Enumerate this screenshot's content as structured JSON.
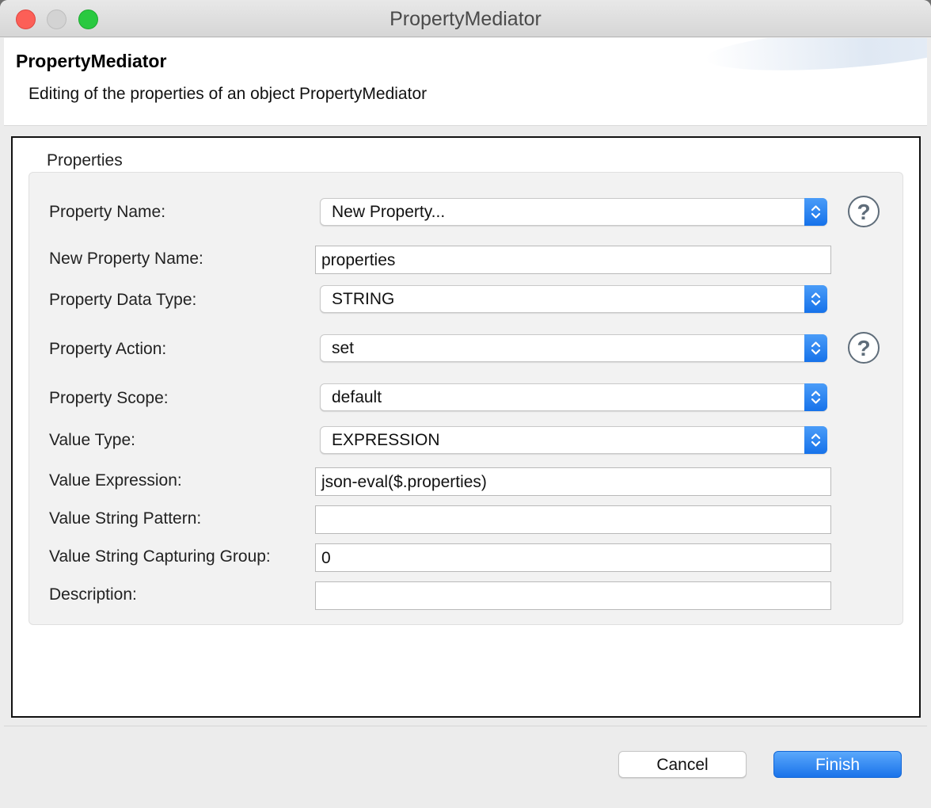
{
  "window": {
    "title": "PropertyMediator"
  },
  "header": {
    "title": "PropertyMediator",
    "description": "Editing of the properties of an object PropertyMediator"
  },
  "group": {
    "label": "Properties"
  },
  "fields": {
    "property_name": {
      "label": "Property Name:",
      "value": "New Property..."
    },
    "new_property_name": {
      "label": "New Property Name:",
      "value": "properties"
    },
    "property_data_type": {
      "label": "Property Data Type:",
      "value": "STRING"
    },
    "property_action": {
      "label": "Property Action:",
      "value": "set"
    },
    "property_scope": {
      "label": "Property Scope:",
      "value": "default"
    },
    "value_type": {
      "label": "Value Type:",
      "value": "EXPRESSION"
    },
    "value_expression": {
      "label": "Value Expression:",
      "value": "json-eval($.properties)"
    },
    "value_string_pattern": {
      "label": "Value String Pattern:",
      "value": ""
    },
    "value_string_capturing_group": {
      "label": "Value String Capturing Group:",
      "value": "0"
    },
    "description": {
      "label": "Description:",
      "value": ""
    }
  },
  "help": {
    "symbol": "?"
  },
  "buttons": {
    "cancel": "Cancel",
    "finish": "Finish"
  },
  "colors": {
    "accent": "#1a73ea",
    "close": "#fc5f57",
    "maximize": "#29c940"
  },
  "icons": {
    "help": "question-circle-icon",
    "dropdown": "up-down-chevron-icon"
  }
}
